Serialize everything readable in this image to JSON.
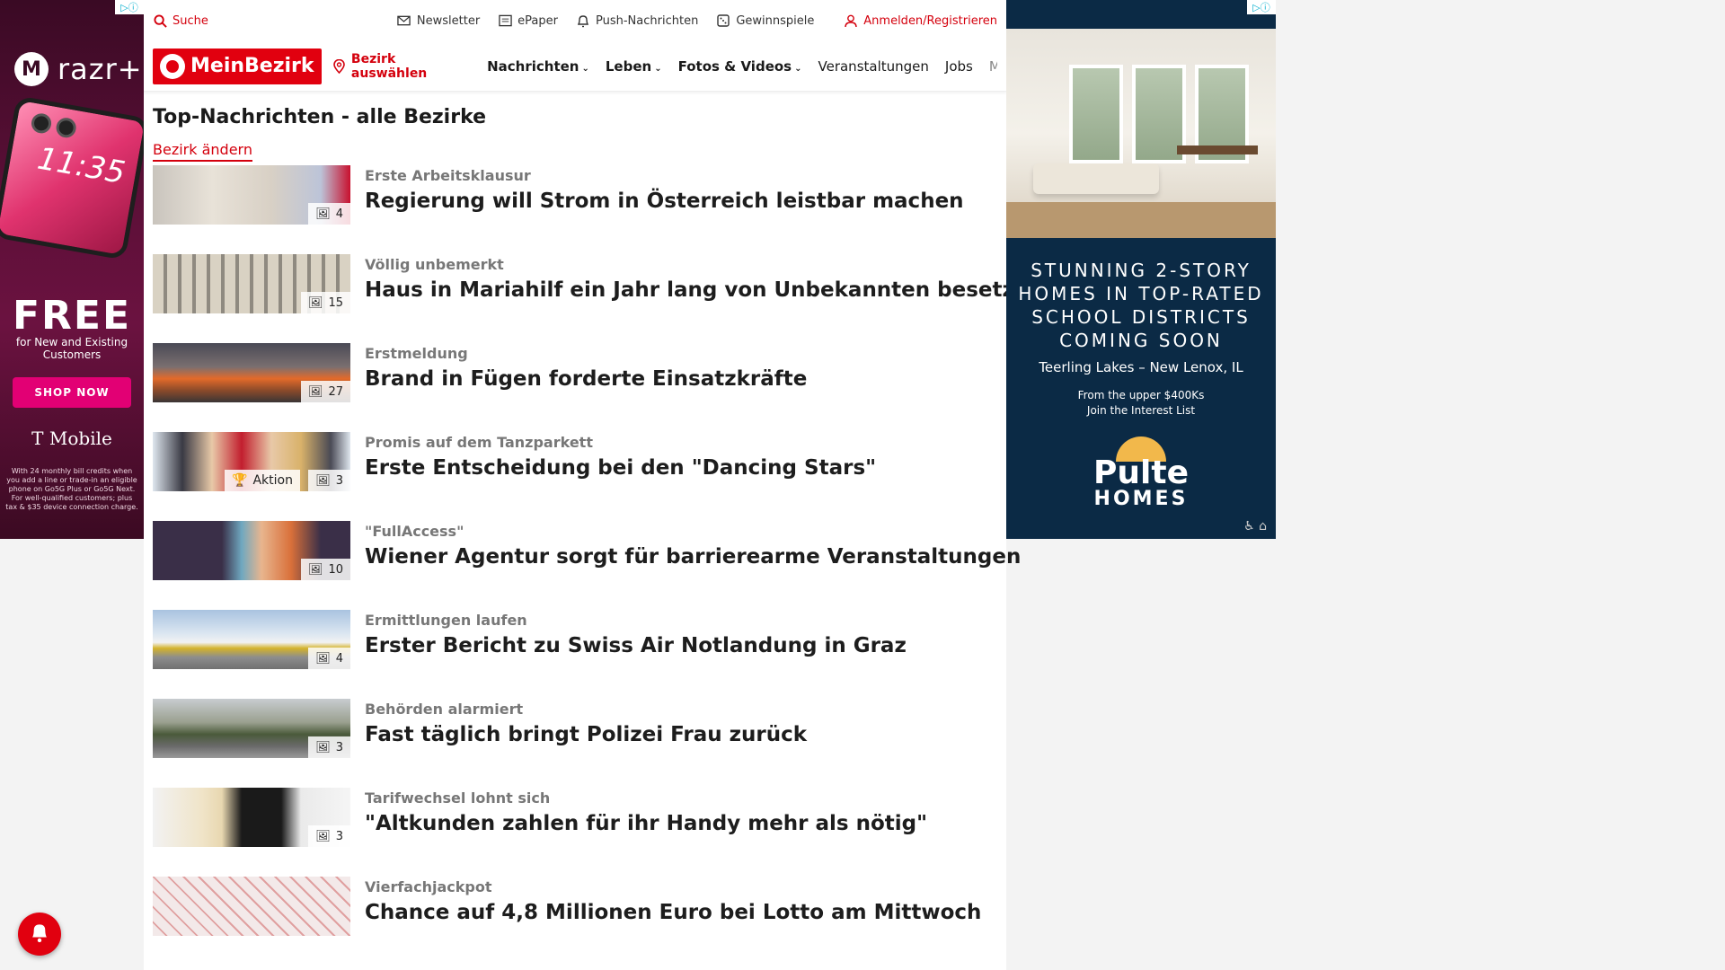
{
  "ad_left": {
    "badge": "▷ⓘ",
    "brand": "razr+",
    "phone_time": "11:35",
    "headline": "FREE",
    "subline": "for New and Existing Customers",
    "cta": "SHOP NOW",
    "advertiser": "T Mobile",
    "fine_print": "With 24 monthly bill credits when you add a line or trade-in an eligible phone on Go5G Plus or Go5G Next. For well-qualified customers; plus tax & $35 device connection charge."
  },
  "topbar": {
    "search": "Suche",
    "newsletter": "Newsletter",
    "epaper": "ePaper",
    "push": "Push-Nachrichten",
    "gewinnspiele": "Gewinnspiele",
    "login": "Anmelden/Registrieren"
  },
  "nav": {
    "logo": "MeinBezirk",
    "bezirk": "Bezirk auswählen",
    "items": [
      {
        "label": "Nachrichten"
      },
      {
        "label": "Leben"
      },
      {
        "label": "Fotos & Videos"
      },
      {
        "label": "Veranstaltungen"
      },
      {
        "label": "Jobs"
      },
      {
        "label": "Marktplatz"
      }
    ]
  },
  "page": {
    "title": "Top-Nachrichten - alle Bezirke",
    "change_link": "Bezirk ändern"
  },
  "articles": [
    {
      "kicker": "Erste Arbeitsklausur",
      "headline": "Regierung will Strom in Österreich leistbar machen",
      "count": "4"
    },
    {
      "kicker": "Völlig unbemerkt",
      "headline": "Haus in Mariahilf ein Jahr lang von Unbekannten besetzt",
      "count": "15"
    },
    {
      "kicker": "Erstmeldung",
      "headline": "Brand in Fügen forderte Einsatzkräfte",
      "count": "27"
    },
    {
      "kicker": "Promis auf dem Tanzparkett",
      "headline": "Erste Entscheidung bei den \"Dancing Stars\"",
      "count": "3",
      "aktion": "Aktion"
    },
    {
      "kicker": "\"FullAccess\"",
      "headline": "Wiener Agentur sorgt für barrierearme Veranstaltungen",
      "count": "10"
    },
    {
      "kicker": "Ermittlungen laufen",
      "headline": "Erster Bericht zu Swiss Air Notlandung in Graz",
      "count": "4"
    },
    {
      "kicker": "Behörden alarmiert",
      "headline": "Fast täglich bringt Polizei Frau zurück",
      "count": "3"
    },
    {
      "kicker": "Tarifwechsel lohnt sich",
      "headline": "\"Altkunden zahlen für ihr Handy mehr als nötig\"",
      "count": "3"
    },
    {
      "kicker": "Vierfachjackpot",
      "headline": "Chance auf 4,8 Millionen Euro bei Lotto am Mittwoch",
      "count": ""
    }
  ],
  "ad_right": {
    "badge": "▷ⓘ",
    "headline_lines": [
      "STUNNING 2-STORY",
      "HOMES IN TOP-RATED",
      "SCHOOL DISTRICTS",
      "COMING SOON"
    ],
    "location": "Teerling Lakes – New Lenox, IL",
    "price": "From the upper $400Ks",
    "interest": "Join the Interest List",
    "brand": "Pulte",
    "brand_sub": "HOMES"
  },
  "colors": {
    "accent": "#e1000f",
    "ad_right_bg": "#0b2a45",
    "tmobile": "#e20074"
  }
}
